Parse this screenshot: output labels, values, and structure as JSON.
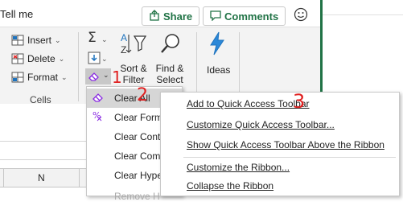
{
  "top": {
    "tell_me": "Tell me",
    "share": "Share",
    "comments": "Comments"
  },
  "ribbon": {
    "cells": {
      "insert": "Insert",
      "delete": "Delete",
      "format": "Format",
      "group_label": "Cells"
    },
    "editing": {
      "sort_filter_1": "Sort &",
      "sort_filter_2": "Filter",
      "find_select_1": "Find &",
      "find_select_2": "Select"
    },
    "ideas": "Ideas"
  },
  "spreadsheet": {
    "column_n": "N"
  },
  "clear_menu": {
    "items": [
      "Clear All",
      "Clear Formats",
      "Clear Contents",
      "Clear Comments",
      "Clear Hyperlinks",
      "Remove Hyperlinks"
    ],
    "items_visible": [
      "Clear All",
      "Clear Form",
      "Clear Cont",
      "Clear Com",
      "Clear Hype",
      "Remove H"
    ]
  },
  "context_menu": {
    "items": [
      "Add to Quick Access Toolbar",
      "Customize Quick Access Toolbar...",
      "Show Quick Access Toolbar Above the Ribbon",
      "Customize the Ribbon...",
      "Collapse the Ribbon"
    ]
  },
  "annotations": {
    "one": "1",
    "two": "2",
    "three": "3"
  },
  "colors": {
    "excel_green": "#217346",
    "annotation_red": "#e02020",
    "icon_purple": "#8a2be2",
    "icon_blue": "#1e73be"
  }
}
